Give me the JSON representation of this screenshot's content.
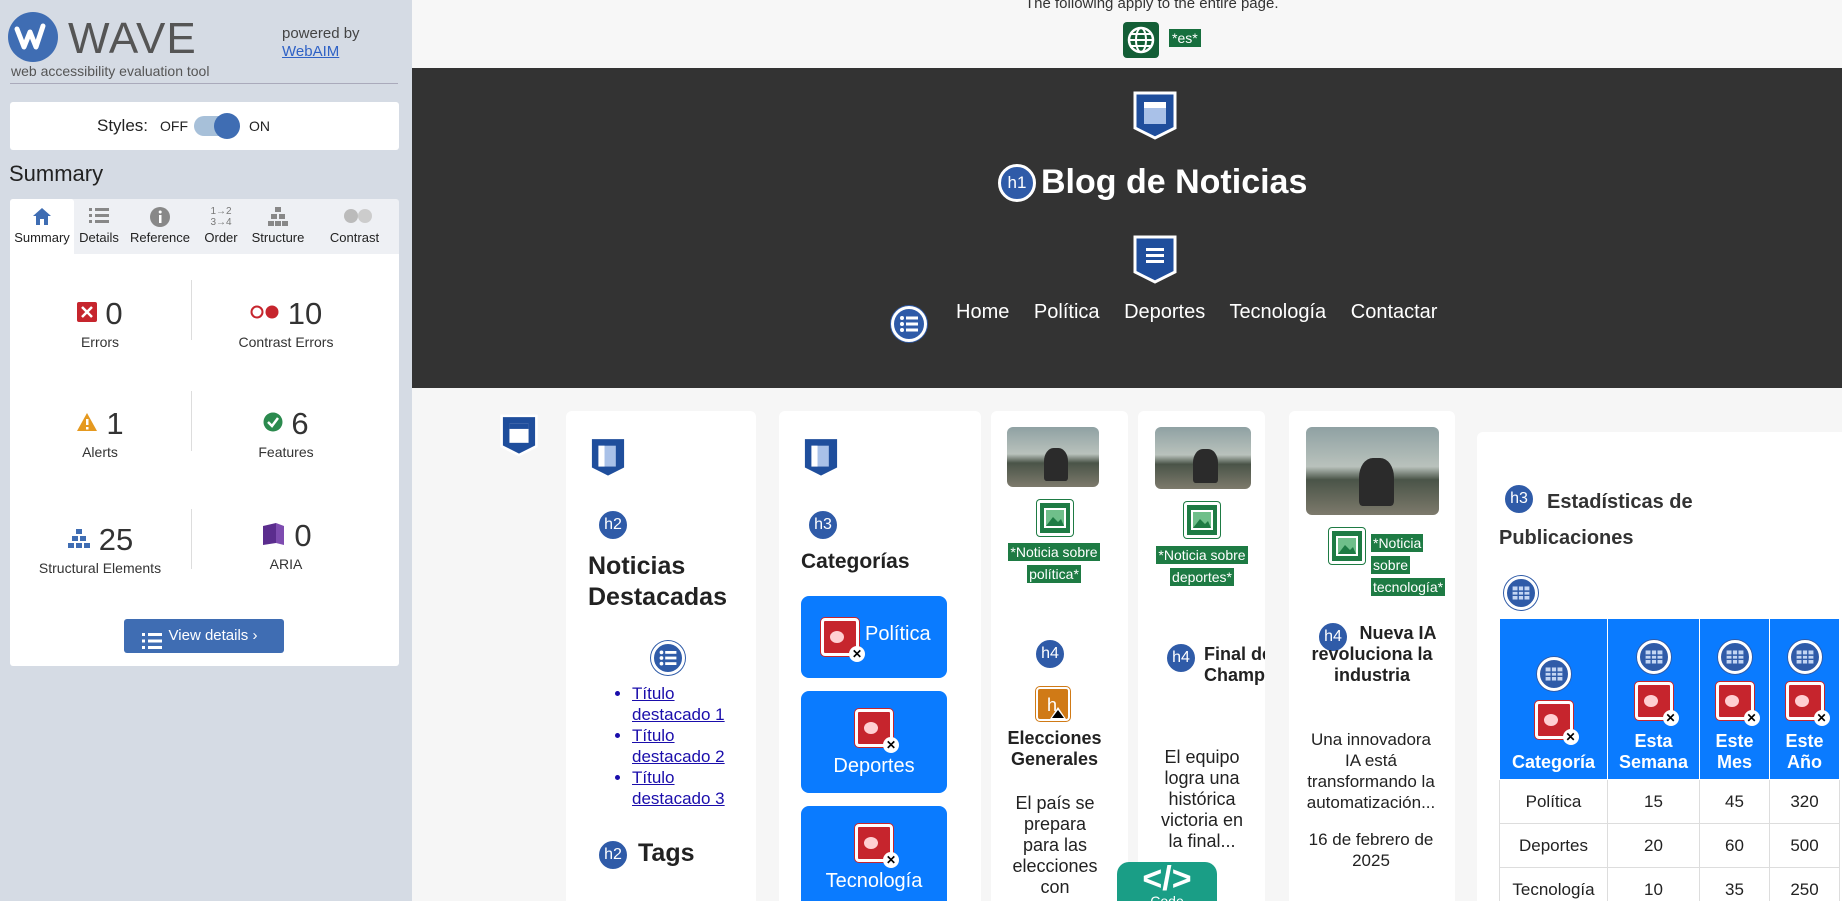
{
  "sidebar": {
    "logo_text": "WAVE",
    "logo_sub": "web accessibility evaluation tool",
    "powered_by": "powered by",
    "webaim_link": "WebAIM",
    "styles_label": "Styles:",
    "styles_off": "OFF",
    "styles_on": "ON",
    "summary_title": "Summary",
    "tabs": [
      {
        "label": "Summary",
        "icon": "home-icon"
      },
      {
        "label": "Details",
        "icon": "list-icon"
      },
      {
        "label": "Reference",
        "icon": "info-icon"
      },
      {
        "label": "Order",
        "icon": "order-icon"
      },
      {
        "label": "Structure",
        "icon": "structure-icon"
      },
      {
        "label": "Contrast",
        "icon": "contrast-icon"
      }
    ],
    "stats": {
      "errors": {
        "value": "0",
        "label": "Errors"
      },
      "contrast_errors": {
        "value": "10",
        "label": "Contrast Errors"
      },
      "alerts": {
        "value": "1",
        "label": "Alerts"
      },
      "features": {
        "value": "6",
        "label": "Features"
      },
      "structural": {
        "value": "25",
        "label": "Structural Elements"
      },
      "aria": {
        "value": "0",
        "label": "ARIA"
      }
    },
    "view_details": "View details ›"
  },
  "page": {
    "applies_text": "The following apply to the entire page.",
    "lang_tag": "*es*",
    "site_title": "Blog de Noticias",
    "h1": "h1",
    "nav": [
      "Home",
      "Política",
      "Deportes",
      "Tecnología",
      "Contactar"
    ],
    "featured": {
      "h_level": "h2",
      "title": "Noticias Destacadas",
      "items": [
        "Título destacado 1",
        "Título destacado 2",
        "Título destacado 3"
      ],
      "tags_level": "h2",
      "tags_title": "Tags"
    },
    "categories": {
      "h_level": "h3",
      "title": "Categorías",
      "buttons": [
        "Política",
        "Deportes",
        "Tecnología"
      ]
    },
    "news": [
      {
        "alt": "*Noticia sobre política*",
        "h_level": "h4",
        "title": "Elecciones Generales",
        "text": "El país se prepara para las elecciones con"
      },
      {
        "alt": "*Noticia sobre deportes*",
        "h_level": "h4",
        "title": "Final de la Champions",
        "text": "El equipo logra una histórica victoria en la final..."
      },
      {
        "alt": "*Noticia sobre tecnología*",
        "h_level": "h4",
        "title": "Nueva IA revoluciona la industria",
        "text": "Una innovadora IA está transformando la automatización...",
        "date": "16 de febrero de 2025"
      }
    ],
    "stats_table": {
      "h_level": "h3",
      "title": "Estadísticas de Publicaciones",
      "headers": [
        "Categoría",
        "Esta Semana",
        "Este Mes",
        "Este Año"
      ],
      "rows": [
        [
          "Política",
          "15",
          "45",
          "320"
        ],
        [
          "Deportes",
          "20",
          "60",
          "500"
        ],
        [
          "Tecnología",
          "10",
          "35",
          "250"
        ]
      ]
    },
    "code_button": "</>",
    "code_label": "Code"
  },
  "colors": {
    "wave_blue": "#3f6db3",
    "header_bg": "#333333",
    "button_blue": "#0a7bff",
    "feature_green": "#1e7b44",
    "error_red": "#c6252d"
  }
}
